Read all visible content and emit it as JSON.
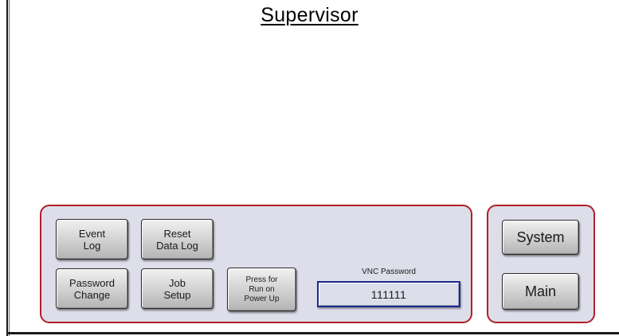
{
  "header": {
    "title": "Supervisor"
  },
  "controls": {
    "event_log_label": "Event\nLog",
    "reset_data_log_label": "Reset\nData Log",
    "password_change_label": "Password\nChange",
    "job_setup_label": "Job\nSetup",
    "run_on_power_up_label": "Press for\nRun on\nPower Up"
  },
  "vnc": {
    "label": "VNC Password",
    "value": "111111"
  },
  "navigation": {
    "system_label": "System",
    "main_label": "Main"
  },
  "colors": {
    "panel_border": "#b21e2a",
    "panel_fill": "#dedeea",
    "field_border": "#1c2a8c"
  }
}
